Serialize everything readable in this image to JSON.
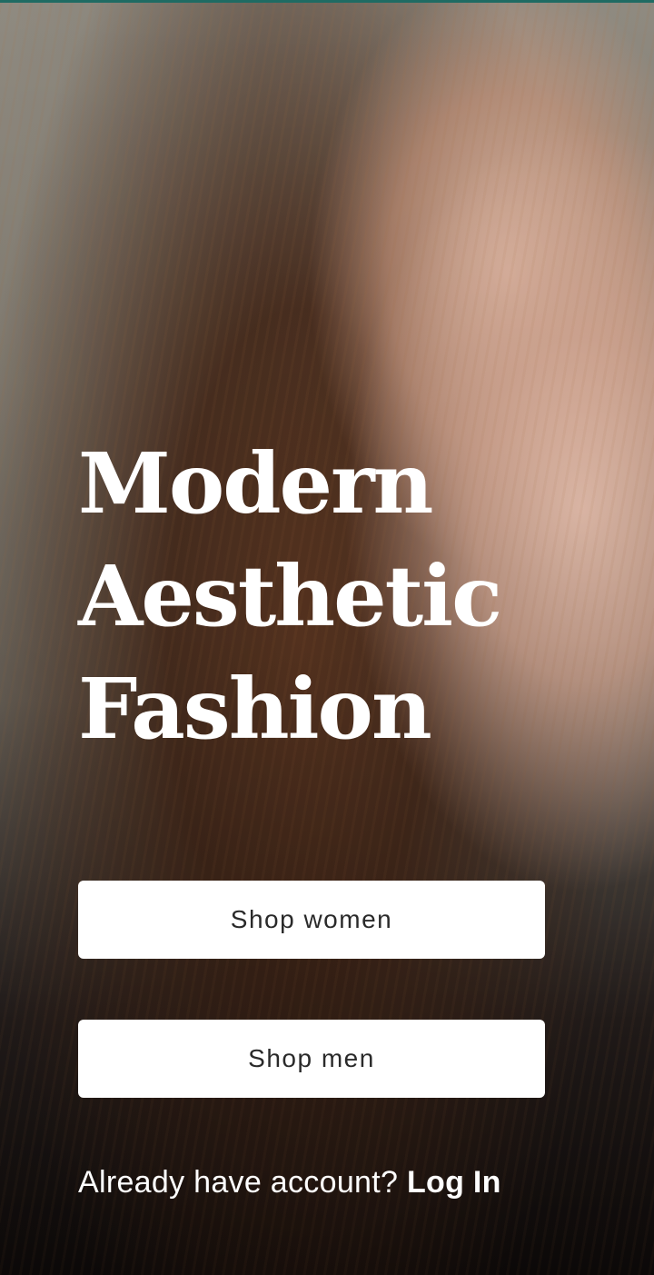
{
  "hero": {
    "headline_lines": [
      "Modern",
      "Aesthetic",
      "Fashion"
    ]
  },
  "actions": {
    "shop_women_label": "Shop women",
    "shop_men_label": "Shop men"
  },
  "auth": {
    "prompt": "Already have account? ",
    "login_label": "Log In"
  },
  "colors": {
    "accent": "#1f6b63",
    "button_bg": "#ffffff",
    "button_text": "#2a2a2a",
    "headline_text": "#ffffff"
  }
}
